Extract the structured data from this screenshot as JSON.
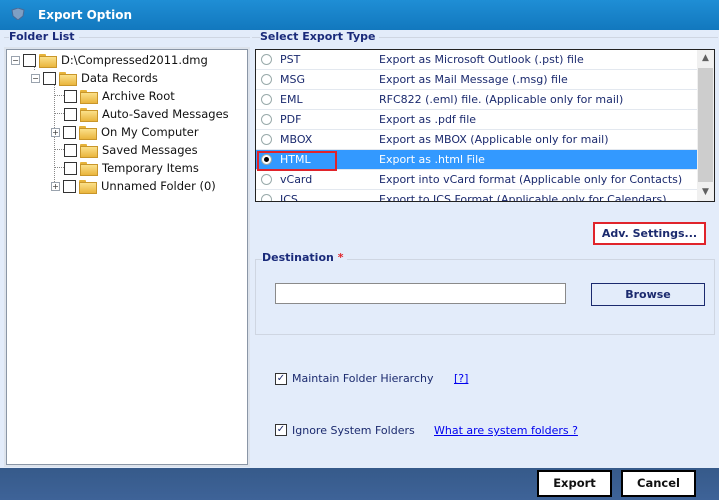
{
  "window": {
    "title": "Export Option",
    "icon": "shield-app-icon"
  },
  "folder_list": {
    "label": "Folder List",
    "tree": [
      {
        "label": "D:\\Compressed2011.dmg",
        "level": 0,
        "expander": "minus",
        "icon": "open-folder-icon",
        "checked": false
      },
      {
        "label": "Data Records",
        "level": 1,
        "expander": "minus",
        "icon": "data-folder-icon",
        "checked": false
      },
      {
        "label": "Archive Root",
        "level": 2,
        "expander": "none",
        "icon": "folder-icon",
        "checked": false
      },
      {
        "label": "Auto-Saved Messages",
        "level": 2,
        "expander": "none",
        "icon": "folder-icon",
        "checked": false
      },
      {
        "label": "On My Computer",
        "level": 2,
        "expander": "plus",
        "icon": "folder-icon",
        "checked": false
      },
      {
        "label": "Saved Messages",
        "level": 2,
        "expander": "none",
        "icon": "folder-icon",
        "checked": false
      },
      {
        "label": "Temporary Items",
        "level": 2,
        "expander": "none",
        "icon": "folder-icon",
        "checked": false
      },
      {
        "label": "Unnamed Folder (0)",
        "level": 2,
        "expander": "plus",
        "icon": "folder-icon",
        "checked": false
      }
    ]
  },
  "export_type": {
    "label": "Select Export Type",
    "selected": "HTML",
    "options": [
      {
        "name": "PST",
        "desc": "Export as Microsoft Outlook (.pst) file"
      },
      {
        "name": "MSG",
        "desc": "Export as Mail Message (.msg) file"
      },
      {
        "name": "EML",
        "desc": "RFC822 (.eml) file. (Applicable only for mail)"
      },
      {
        "name": "PDF",
        "desc": "Export as .pdf file"
      },
      {
        "name": "MBOX",
        "desc": "Export as MBOX (Applicable only for mail)"
      },
      {
        "name": "HTML",
        "desc": "Export as .html File"
      },
      {
        "name": "vCard",
        "desc": "Export into vCard format (Applicable only for Contacts)"
      },
      {
        "name": "ICS",
        "desc": "Export to ICS Format (Applicable only for Calendars)"
      }
    ]
  },
  "adv_settings_label": "Adv. Settings...",
  "destination": {
    "label": "Destination",
    "required_mark": "*",
    "value": "",
    "placeholder": "",
    "browse_label": "Browse"
  },
  "options": {
    "maintain_hierarchy": {
      "label": "Maintain Folder Hierarchy",
      "checked": true,
      "help_link": "[?]"
    },
    "ignore_system": {
      "label": "Ignore System Folders",
      "checked": true,
      "help_link": "What are system folders ?"
    }
  },
  "footer": {
    "export_label": "Export",
    "cancel_label": "Cancel"
  },
  "colors": {
    "accent": "#1278be",
    "selection": "#3399ff",
    "highlight": "#e0242b",
    "text": "#1b2a6e",
    "footer": "#3a5e90"
  }
}
